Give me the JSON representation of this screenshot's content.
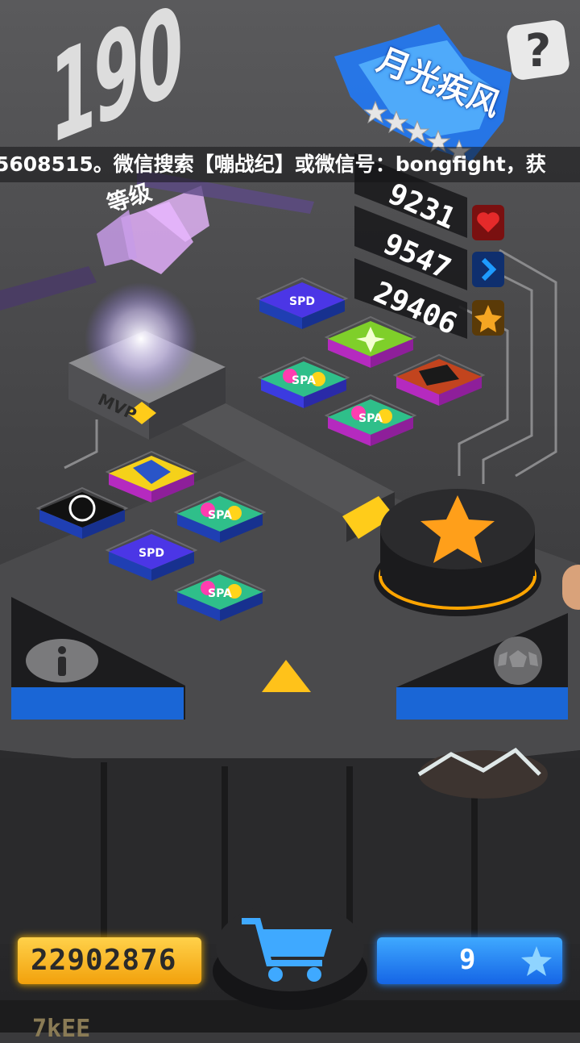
{
  "marquee": {
    "text": "5608515。微信搜索【嘣战纪】或微信号：bongfight，获"
  },
  "level": {
    "number": "190",
    "label": "等级"
  },
  "character": {
    "title": "月光疾风",
    "stars": 5
  },
  "stats": {
    "hp": {
      "value": "9231",
      "icon": "heart-icon",
      "color": "#e52a2a"
    },
    "speed": {
      "value": "9547",
      "icon": "chevron-right-icon",
      "color": "#1e7bff"
    },
    "attack": {
      "value": "29406",
      "icon": "star-icon",
      "color": "#f5a623"
    }
  },
  "board": {
    "tiles": [
      {
        "label": "SPD",
        "color": "#5b3df0"
      },
      {
        "label": "",
        "color": "#8fd13a"
      },
      {
        "label": "SPA",
        "color": "#ff3db0"
      },
      {
        "label": "",
        "color": "#c2441e"
      },
      {
        "label": "SPA",
        "color": "#ff3db0"
      },
      {
        "label": "",
        "color": "#f5d11a"
      },
      {
        "label": "",
        "color": "#ffffff"
      },
      {
        "label": "SPA",
        "color": "#ff3db0"
      },
      {
        "label": "SPD",
        "color": "#5b3df0"
      },
      {
        "label": "SPA",
        "color": "#ff3db0"
      }
    ],
    "pedestal_label": "MVP"
  },
  "currency": {
    "coins": "22902876",
    "gems": "9"
  },
  "bottom_partial": {
    "text": "7kEE"
  },
  "colors": {
    "accent_orange": "#ff9f1a",
    "accent_blue": "#1e88ff",
    "bg": "#3a3a3c"
  }
}
